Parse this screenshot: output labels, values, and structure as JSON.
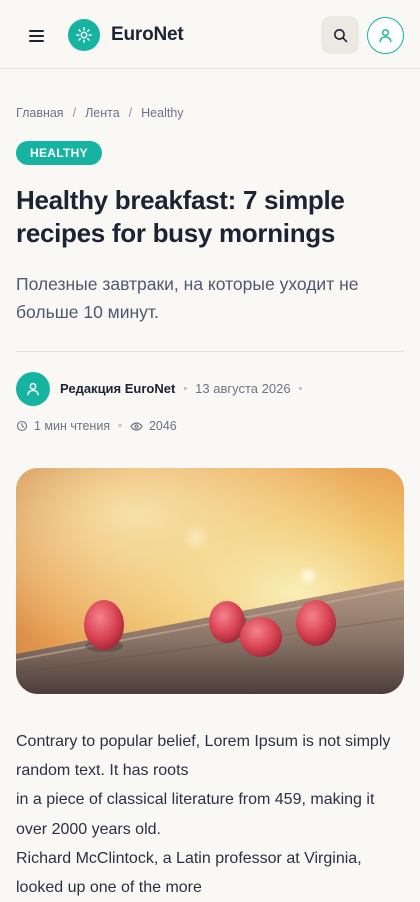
{
  "header": {
    "menu_icon": "hamburger-menu-icon",
    "logo_icon": "sun-icon",
    "brand": "EuroNet",
    "search_icon": "search-icon",
    "account_icon": "user-icon",
    "accent": "#16b3a0"
  },
  "breadcrumb": {
    "items": [
      "Главная",
      "Лента",
      "Healthy"
    ],
    "separator": "/"
  },
  "article": {
    "category": "HEALTHY",
    "title": "Healthy breakfast: 7 simple recipes for busy mornings",
    "subtitle": "Полезные завтраки, на которые уходит не больше 10 минут.",
    "author": "Редакция EuroNet",
    "date": "13 августа 2026",
    "reading_time": "1 мин чтения",
    "views": "2046",
    "image_alt": "raspberries-on-wooden-plank",
    "paragraphs": [
      "Contrary to popular belief, Lorem Ipsum is not simply random text. It has roots",
      "in a piece of classical literature from 459, making it over 2000 years old.",
      "Richard McClintock, a Latin professor at Virginia, looked up one of the more"
    ]
  }
}
